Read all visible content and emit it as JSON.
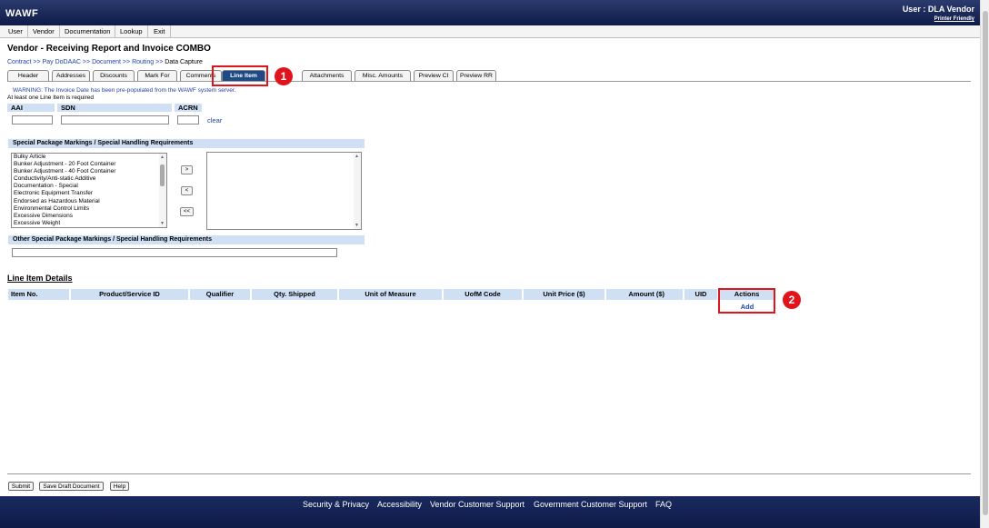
{
  "header": {
    "brand": "WAWF",
    "user": "User : DLA Vendor",
    "printer_friendly": "Printer Friendly"
  },
  "menu": [
    "User",
    "Vendor",
    "Documentation",
    "Lookup",
    "Exit"
  ],
  "page_title": "Vendor - Receiving Report and Invoice COMBO",
  "breadcrumb": {
    "links": [
      "Contract",
      "Pay DoDAAC",
      "Document",
      "Routing"
    ],
    "sep": ">>",
    "current": "Data Capture"
  },
  "tabs": [
    "Header",
    "Addresses",
    "Discounts",
    "Mark For",
    "Comments",
    "Line Item",
    "Attachments",
    "Misc. Amounts",
    "Preview CI",
    "Preview RR"
  ],
  "active_tab": "Line Item",
  "callouts": [
    "1",
    "2"
  ],
  "warning": "WARNING: The Invoice Date has been pre-populated from the WAWF system server.",
  "required_note": "At least one Line Item is required",
  "fields": {
    "aai": "AAI",
    "sdn": "SDN",
    "acrn": "ACRN",
    "clear": "clear"
  },
  "special_package": {
    "header": "Special Package Markings / Special Handling Requirements",
    "options": [
      "Bulky Article",
      "Bunker Adjustment - 20 Foot Container",
      "Bunker Adjustment - 40 Foot Container",
      "Conductivity/Anti-static Additive",
      "Documentation - Special",
      "Electronic Equipment Transfer",
      "Endorsed as Hazardous Material",
      "Environmental Control Limits",
      "Excessive Dimensions",
      "Excessive Weight"
    ],
    "buttons": [
      ">",
      "<",
      "<<"
    ],
    "other_header": "Other Special Package Markings / Special Handling Requirements"
  },
  "line_item_details": {
    "title": "Line Item Details",
    "columns": [
      "Item No.",
      "Product/Service ID",
      "Qualifier",
      "Qty. Shipped",
      "Unit of Measure",
      "UofM Code",
      "Unit Price ($)",
      "Amount ($)",
      "UID",
      "Actions"
    ],
    "add_label": "Add"
  },
  "bottom_buttons": [
    "Submit",
    "Save Draft Document",
    "Help"
  ],
  "footer_links": [
    "Security & Privacy",
    "Accessibility",
    "Vendor Customer Support",
    "Government Customer Support",
    "FAQ"
  ],
  "colors": {
    "header_bg": "#0e1b48",
    "active_tab": "#1e4a86",
    "highlight": "#e0141a",
    "section_bg": "#cfe0f5",
    "link": "#2244aa"
  }
}
